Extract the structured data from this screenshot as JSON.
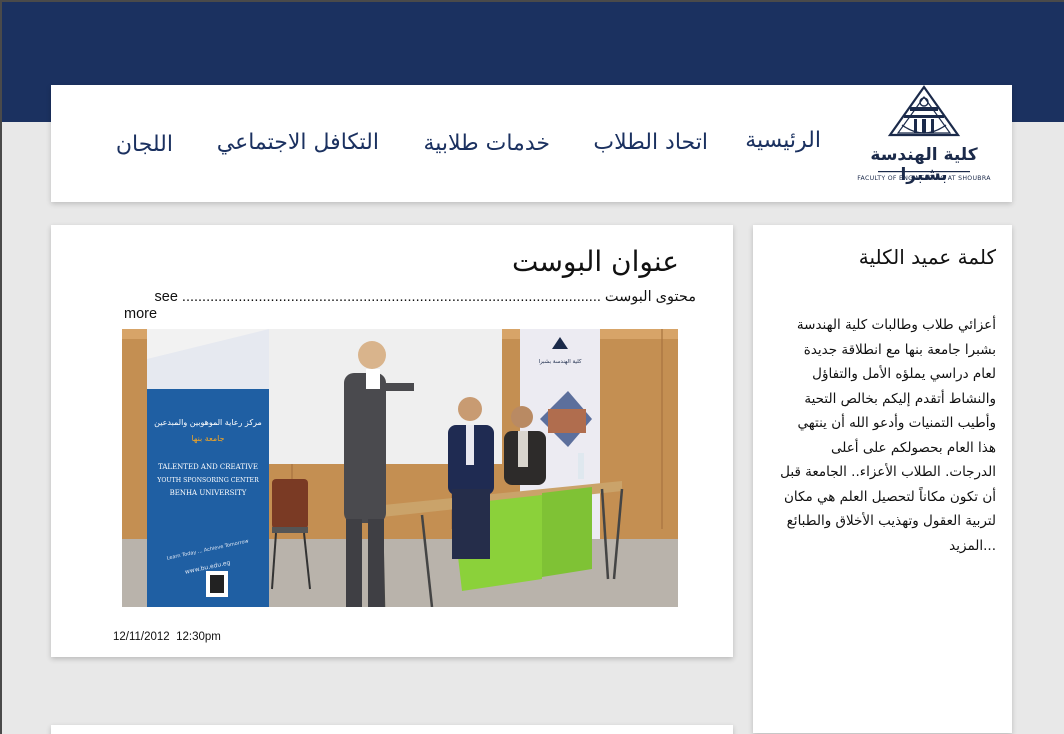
{
  "header": {
    "logo": {
      "title_ar": "كلية الهندسة بشبرا",
      "title_en": "FACULTY OF ENGINEERING AT SHOUBRA",
      "ring_text": "BENHA UNIVERSITY"
    },
    "nav": [
      {
        "label": "الرئيسية"
      },
      {
        "label": "اتحاد الطلاب"
      },
      {
        "label": "خدمات طلابية"
      },
      {
        "label": "التكافل الاجتماعي"
      },
      {
        "label": "اللجان"
      }
    ]
  },
  "post": {
    "title": "عنوان البوست",
    "content": "محتوى البوست ........................................................................................................ see",
    "more": "more",
    "image": {
      "banner_left_ar_1": "مركز رعاية الموهوبين والمبدعين",
      "banner_left_ar_2": "جامعة بنها",
      "banner_left_en_1": "TALENTED AND CREATIVE",
      "banner_left_en_2": "YOUTH SPONSORING CENTER",
      "banner_left_en_3": "BENHA UNIVERSITY",
      "banner_left_slogan": "Learn Today ... Achieve Tomorrow",
      "banner_left_url": "www.bu.edu.eg",
      "banner_right_ar": "كلية الهندسة بشبرا"
    },
    "date": "12/11/2012",
    "time": "12:30pm"
  },
  "dean": {
    "title": "كلمة عميد الكلية",
    "lines": [
      "أعزائي طلاب وطالبات كلية الهندسة",
      "بشبرا جامعة بنها مع انطلاقة جديدة",
      "لعام دراسي يملؤه الأمل والتفاؤل",
      "والنشاط أتقدم إليكم بخالص التحية",
      "وأطيب التمنيات وأدعو الله أن ينتهي",
      "هذا العام بحصولكم على أعلى",
      "الدرجات. الطلاب الأعزاء.. الجامعة قبل",
      "أن تكون مكاناً لتحصيل العلم هي مكان",
      "لتربية العقول وتهذيب الأخلاق والطبائع",
      "...المزيد"
    ]
  },
  "colors": {
    "brand_navy": "#1b3160",
    "page_bg": "#e8e8e8",
    "card_bg": "#ffffff"
  }
}
